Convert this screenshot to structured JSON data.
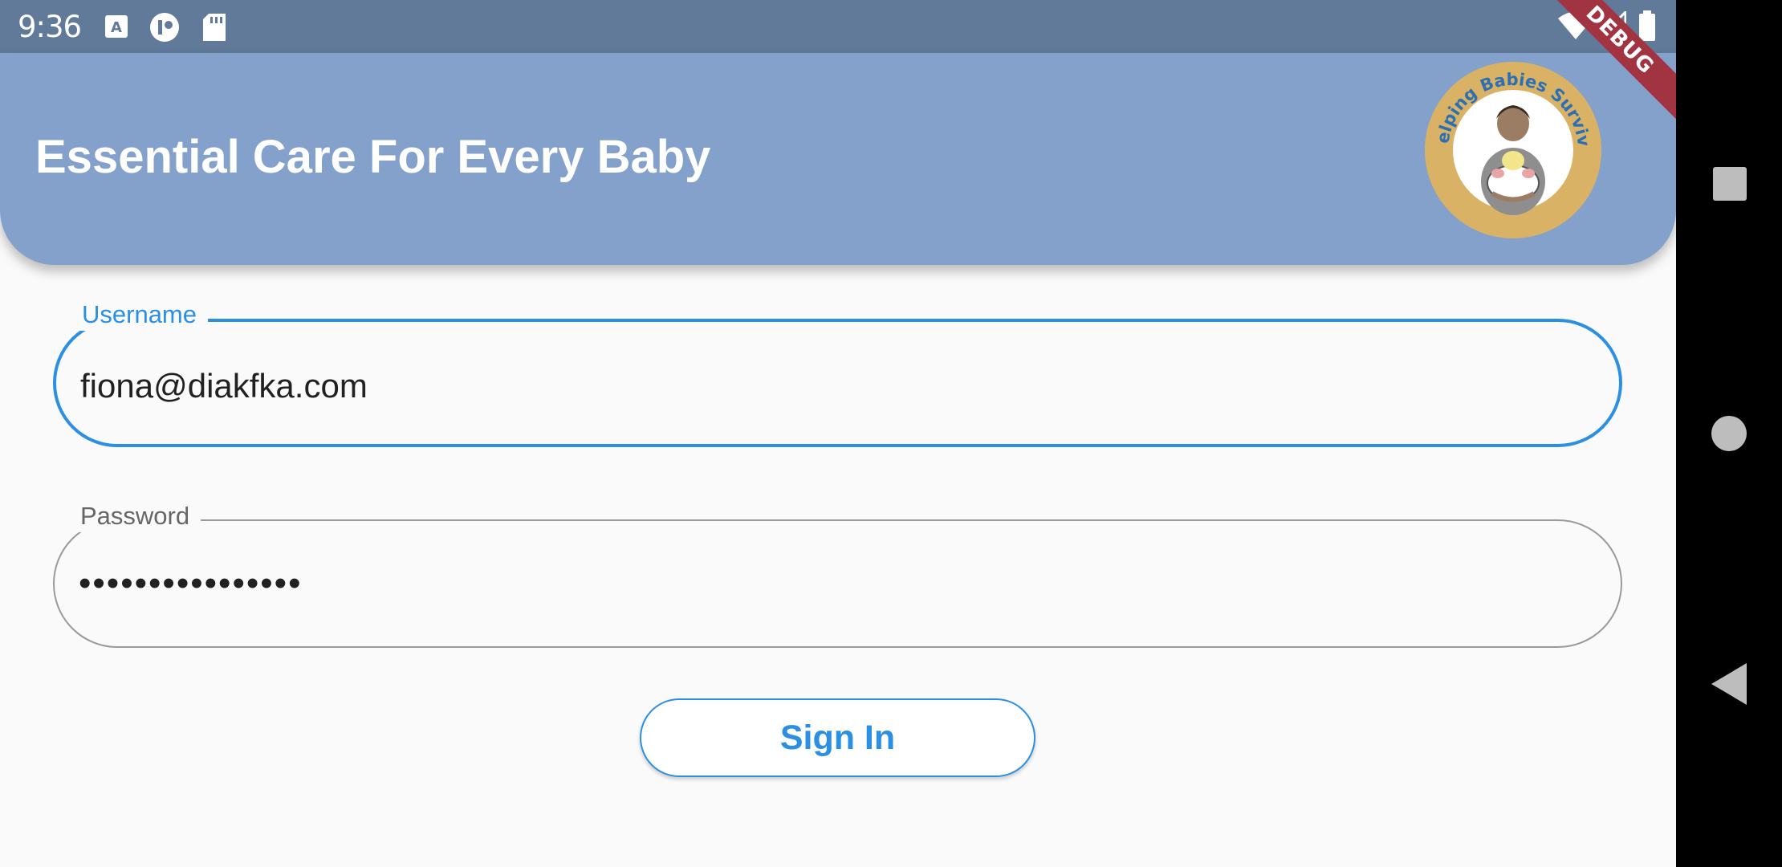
{
  "status_bar": {
    "time": "9:36",
    "icons": [
      "a-notification-icon",
      "record-icon",
      "sd-card-icon",
      "wifi-icon",
      "cell-signal-icon",
      "battery-icon"
    ]
  },
  "app_bar": {
    "title": "Essential Care For Every Baby",
    "logo_text": "Helping Babies Survive",
    "background": "#83a1ca"
  },
  "debug_banner": "DEBUG",
  "form": {
    "username": {
      "label": "Username",
      "value": "fiona@diakfka.com"
    },
    "password": {
      "label": "Password",
      "value": "••••••••••••••••"
    },
    "sign_in_label": "Sign In",
    "accent": "#2b8fe3"
  },
  "nav": {
    "icons": [
      "recents-square-icon",
      "home-circle-icon",
      "back-triangle-icon"
    ]
  }
}
